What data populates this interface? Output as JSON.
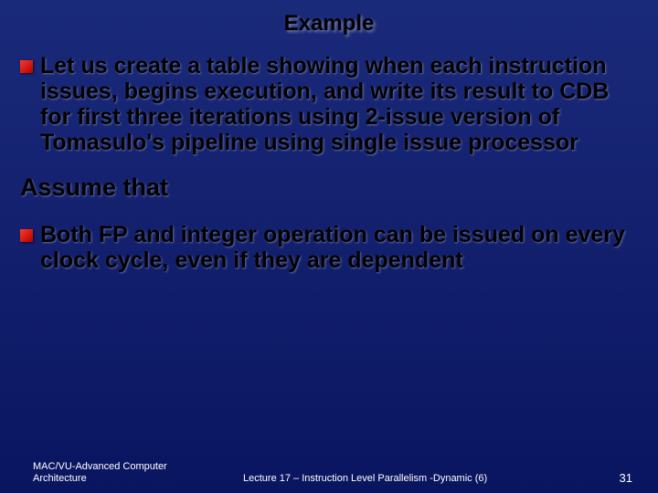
{
  "title": "Example",
  "bullets": [
    "Let us create a table showing when each instruction issues, begins execution, and write its result to CDB for first three iterations using 2-issue version of Tomasulo's pipeline using single issue processor",
    "Both FP and integer operation can be issued on every clock cycle, even if they are dependent"
  ],
  "subhead": "Assume that",
  "footer": {
    "left": "MAC/VU-Advanced Computer Architecture",
    "center": "Lecture 17 – Instruction Level Parallelism -Dynamic (6)",
    "right": "31"
  }
}
